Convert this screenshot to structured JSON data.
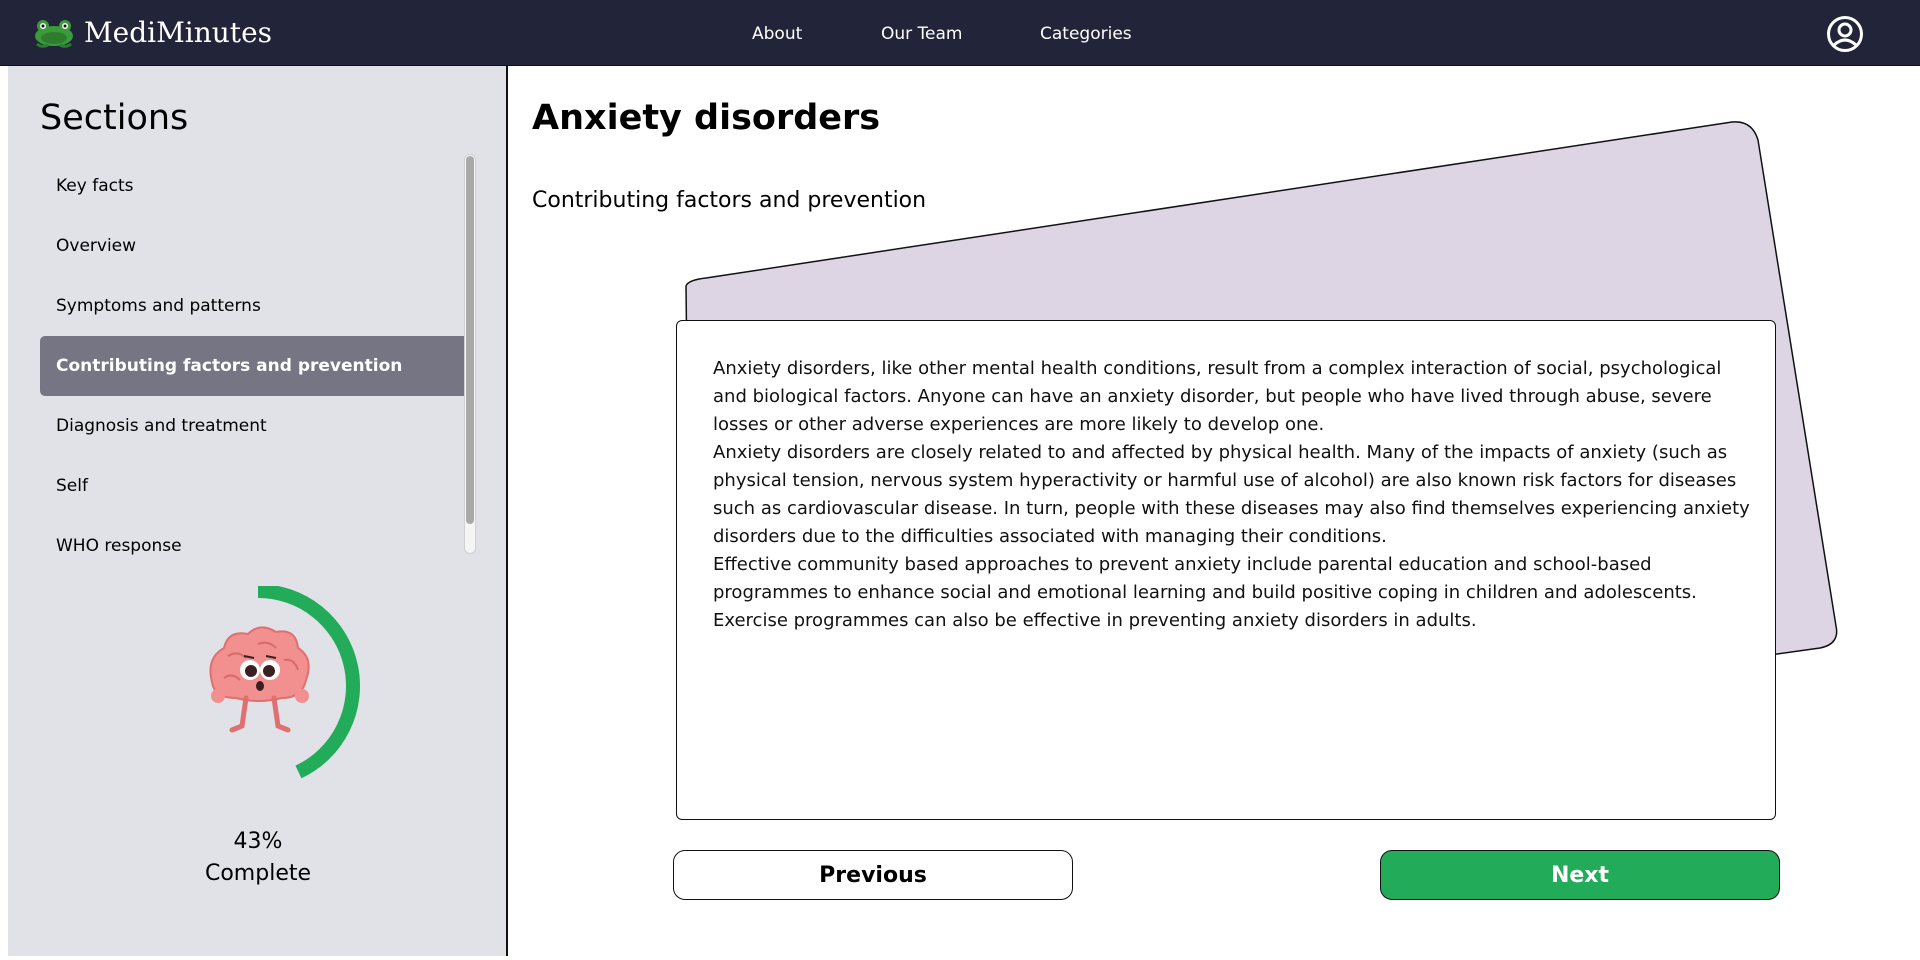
{
  "header": {
    "brand": "MediMinutes",
    "nav": [
      {
        "label": "About"
      },
      {
        "label": "Our Team"
      },
      {
        "label": "Categories"
      }
    ],
    "icons": {
      "logo": "frog-logo-icon",
      "account": "user-circle-icon"
    }
  },
  "sidebar": {
    "title": "Sections",
    "items": [
      {
        "label": "Key facts"
      },
      {
        "label": "Overview"
      },
      {
        "label": "Symptoms and patterns"
      },
      {
        "label": "Contributing factors and prevention",
        "active": true
      },
      {
        "label": "Diagnosis and treatment"
      },
      {
        "label": "Self"
      },
      {
        "label": "WHO response"
      }
    ],
    "progress": {
      "value": 43,
      "percent_text": "43%",
      "label": "Complete",
      "color": "#22ab58",
      "mascot": "brain-mascot-icon"
    }
  },
  "main": {
    "title": "Anxiety disorders",
    "subtitle": "Contributing factors and prevention",
    "paragraphs": [
      "Anxiety disorders, like other mental health conditions, result from a complex interaction of social, psychological and biological factors. Anyone can have an anxiety disorder, but people who have lived through abuse, severe losses or other adverse experiences are more likely to develop one.",
      "Anxiety disorders are closely related to and affected by physical health. Many of the impacts of anxiety (such as physical tension, nervous system hyperactivity or harmful use of alcohol) are also known risk factors for diseases such as cardiovascular disease. In turn, people with these diseases may also find themselves experiencing anxiety disorders due to the difficulties associated with managing their conditions.",
      "Effective community based approaches to prevent anxiety include parental education and school-based programmes to enhance social and emotional learning and build positive coping in children and adolescents. Exercise programmes can also be effective in preventing anxiety disorders in adults."
    ],
    "buttons": {
      "previous": "Previous",
      "next": "Next"
    }
  },
  "colors": {
    "header_bg": "#22253a",
    "sidebar_bg": "#e1e1e8",
    "active_item": "#757584",
    "back_card": "#ddd5e4",
    "accent_green": "#22ab58"
  }
}
